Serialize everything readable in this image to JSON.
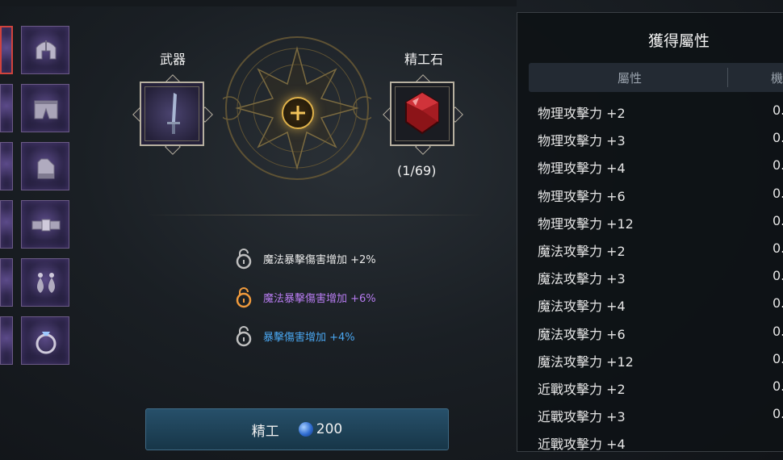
{
  "craft": {
    "weapon_label": "武器",
    "stone_label": "精工石",
    "stone_count": "(1/69)"
  },
  "bonuses": [
    {
      "text": "魔法暴擊傷害增加 +2%",
      "color": "#e8e8e8",
      "lock_color": "#bfbfbf"
    },
    {
      "text": "魔法暴擊傷害增加 +6%",
      "color": "#b77cf0",
      "lock_color": "#f09a3c"
    },
    {
      "text": "暴擊傷害增加 +4%",
      "color": "#4aa6f0",
      "lock_color": "#bfbfbf"
    }
  ],
  "craft_button": {
    "label": "精工",
    "cost": "200"
  },
  "panel": {
    "title": "獲得屬性",
    "col_attribute": "屬性",
    "col_chance": "機",
    "rows": [
      {
        "name": "物理攻擊力 +2",
        "value": "0."
      },
      {
        "name": "物理攻擊力 +3",
        "value": "0."
      },
      {
        "name": "物理攻擊力 +4",
        "value": "0."
      },
      {
        "name": "物理攻擊力 +6",
        "value": "0."
      },
      {
        "name": "物理攻擊力 +12",
        "value": "0."
      },
      {
        "name": "魔法攻擊力 +2",
        "value": "0."
      },
      {
        "name": "魔法攻擊力 +3",
        "value": "0."
      },
      {
        "name": "魔法攻擊力 +4",
        "value": "0."
      },
      {
        "name": "魔法攻擊力 +6",
        "value": "0."
      },
      {
        "name": "魔法攻擊力 +12",
        "value": "0."
      },
      {
        "name": "近戰攻擊力 +2",
        "value": "0."
      },
      {
        "name": "近戰攻擊力 +3",
        "value": "0."
      },
      {
        "name": "近戰攻擊力 +4",
        "value": ""
      }
    ]
  },
  "equipment_slots": [
    {
      "icon": "helmet-icon"
    },
    {
      "icon": "pants-icon"
    },
    {
      "icon": "gloves-icon"
    },
    {
      "icon": "belt-icon"
    },
    {
      "icon": "earrings-icon"
    },
    {
      "icon": "ring-icon"
    }
  ],
  "colors": {
    "accent_gold": "#e0b24a",
    "panel_bg": "#0e1216",
    "button_bg": "#27506a"
  }
}
